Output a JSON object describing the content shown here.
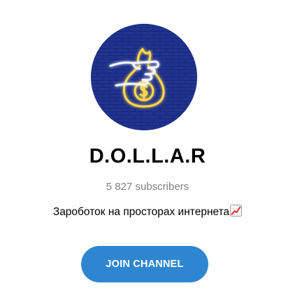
{
  "channel": {
    "title": "D.O.L.L.A.R",
    "subscribers": "5 827 subscribers",
    "description": "Зароботок на просторах интернета",
    "description_emoji": "chart-increasing-icon",
    "avatar_icon": "money-bag-in-hand-icon"
  },
  "actions": {
    "join_label": "JOIN CHANNEL"
  },
  "colors": {
    "button": "#2f86d0",
    "subscribers_text": "#808080",
    "avatar_background": "#1f2f86",
    "neon_gold": "#ffd84a"
  }
}
